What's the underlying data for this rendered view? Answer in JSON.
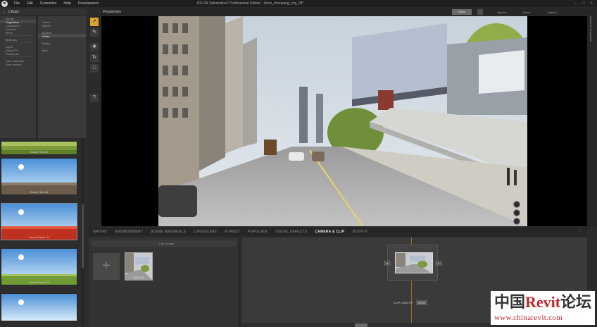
{
  "app": {
    "title": "KR-RA Twinmotion2 Professional Edition - dorm_zhoupang_city_08*",
    "menu": [
      "File",
      "Edit",
      "Customize",
      "Help",
      "Development"
    ]
  },
  "library": {
    "title": "Library",
    "categories": [
      "Terrain",
      "Vegetation",
      "Characters",
      "Vehicles",
      "Items",
      "Materials",
      "Lights",
      "Visual FX",
      "Resources",
      "User materials",
      "User models"
    ],
    "active_category": "Vegetation",
    "subcategories": [
      "Urban",
      "Nature",
      "Bushes",
      "Grass",
      "Rocks",
      "Misc"
    ],
    "active_subcategory": "Grass",
    "thumbnails": [
      {
        "label": "Grass Field 03"
      },
      {
        "label": "Grass Field 04"
      },
      {
        "label": "Grass Flower 01"
      },
      {
        "label": "Grass Flower 02"
      },
      {
        "label": ""
      }
    ]
  },
  "tools": {
    "select_icon": "cursor-arrow",
    "paint_icon": "brush",
    "move_icon": "move-cross",
    "rotate_icon": "rotate",
    "scale_icon": "square",
    "help_label": "?"
  },
  "viewport": {
    "mode_label": "Perspective",
    "drive_label": "Drive",
    "options": [
      "Options",
      "Views",
      "Batch 0"
    ]
  },
  "right_panel": {
    "label": "Advanced properties"
  },
  "tabs": {
    "items": [
      "IMPORT",
      "ENVIRONMENT",
      "SCENE MATERIALS",
      "LANDSCAPE",
      "FOREST",
      "POPULATE",
      "VISUAL EFFECTS",
      "CAMERA & CLIP",
      "OUTPUT"
    ],
    "active": "CAMERA & CLIP"
  },
  "clips": {
    "header": "Clip storage",
    "add_label": "+",
    "items": [
      {
        "label": "Cam 001"
      }
    ]
  },
  "timeline": {
    "clip_length_label": "CLIP LENGTH",
    "clip_length_value": "00:00"
  },
  "watermark": {
    "cn_prefix": "中国",
    "brand": "Revit",
    "cn_suffix": "论坛",
    "url": "www.chinarevit.com"
  },
  "colors": {
    "accent": "#d8a531",
    "panel": "#2b2b2b",
    "timeline_marker": "#b5742a",
    "watermark_red": "#c1272d"
  }
}
